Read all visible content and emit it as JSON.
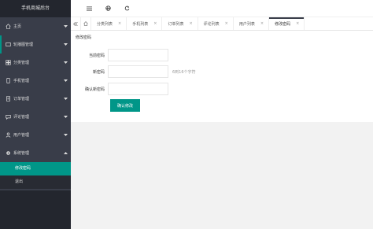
{
  "sidebar": {
    "title": "手机商城后台",
    "items": [
      {
        "label": "主页",
        "icon": "home-icon"
      },
      {
        "label": "轮播图管理",
        "icon": "carousel-icon"
      },
      {
        "label": "分类管理",
        "icon": "category-icon"
      },
      {
        "label": "手机管理",
        "icon": "phone-icon"
      },
      {
        "label": "订单管理",
        "icon": "order-icon"
      },
      {
        "label": "评论管理",
        "icon": "comment-icon"
      },
      {
        "label": "用户管理",
        "icon": "user-icon"
      },
      {
        "label": "系统管理",
        "icon": "gear-icon"
      }
    ],
    "sub_items": [
      {
        "label": "修改密码",
        "selected": true
      },
      {
        "label": "退出",
        "selected": false
      }
    ]
  },
  "header": {
    "icons": [
      "menu-toggle-icon",
      "globe-icon",
      "refresh-icon"
    ]
  },
  "tabs": [
    {
      "label": "分类列表",
      "active": false
    },
    {
      "label": "手机列表",
      "active": false
    },
    {
      "label": "订单列表",
      "active": false
    },
    {
      "label": "评论列表",
      "active": false
    },
    {
      "label": "用户列表",
      "active": false
    },
    {
      "label": "修改密码",
      "active": true
    }
  ],
  "tab_close": "×",
  "main": {
    "breadcrumb": "修改密码",
    "form": {
      "current_password_label": "当前密码",
      "new_password_label": "新密码",
      "new_password_hint": "6到16个字符",
      "confirm_password_label": "确认新密码",
      "submit_label": "确认修改"
    }
  },
  "colors": {
    "accent": "#009688",
    "sidebar_bg": "#393d49",
    "sidebar_dark": "#23262e"
  }
}
